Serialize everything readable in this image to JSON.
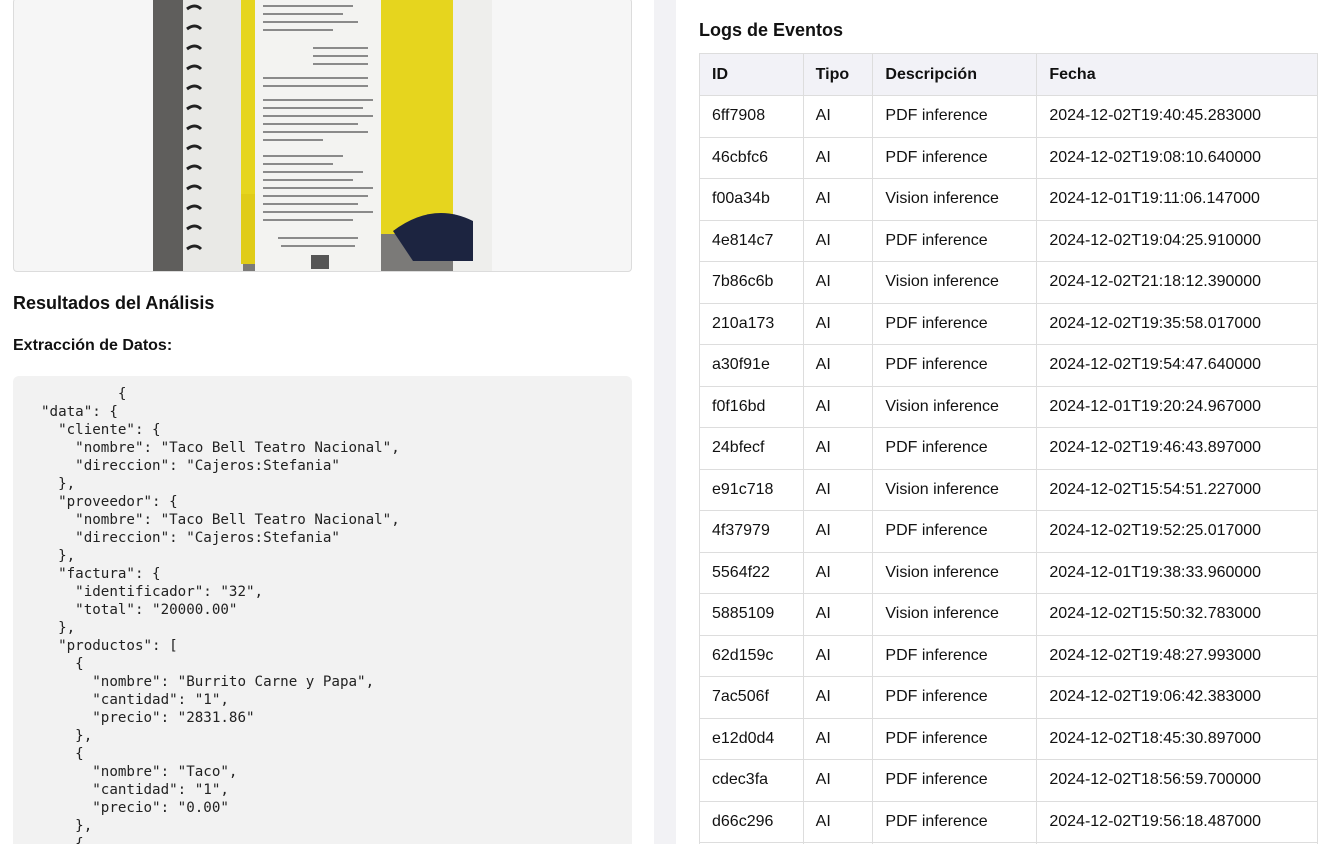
{
  "left_panel": {
    "receipt_image_alt": "Taco Bell Teatro Nacional receipt",
    "analysis_title": "Resultados del Análisis",
    "extraction_title": "Extracción de Datos:",
    "json_output": "         {\n\"data\": {\n  \"cliente\": {\n    \"nombre\": \"Taco Bell Teatro Nacional\",\n    \"direccion\": \"Cajeros:Stefania\"\n  },\n  \"proveedor\": {\n    \"nombre\": \"Taco Bell Teatro Nacional\",\n    \"direccion\": \"Cajeros:Stefania\"\n  },\n  \"factura\": {\n    \"identificador\": \"32\",\n    \"total\": \"20000.00\"\n  },\n  \"productos\": [\n    {\n      \"nombre\": \"Burrito Carne y Papa\",\n      \"cantidad\": \"1\",\n      \"precio\": \"2831.86\"\n    },\n    {\n      \"nombre\": \"Taco\",\n      \"cantidad\": \"1\",\n      \"precio\": \"0.00\"\n    },\n    {"
  },
  "logs": {
    "title": "Logs de Eventos",
    "columns": [
      "ID",
      "Tipo",
      "Descripción",
      "Fecha"
    ],
    "rows": [
      {
        "id": "6ff7908",
        "tipo": "AI",
        "descripcion": "PDF inference",
        "fecha": "2024-12-02T19:40:45.283000"
      },
      {
        "id": "46cbfc6",
        "tipo": "AI",
        "descripcion": "PDF inference",
        "fecha": "2024-12-02T19:08:10.640000"
      },
      {
        "id": "f00a34b",
        "tipo": "AI",
        "descripcion": "Vision inference",
        "fecha": "2024-12-01T19:11:06.147000"
      },
      {
        "id": "4e814c7",
        "tipo": "AI",
        "descripcion": "PDF inference",
        "fecha": "2024-12-02T19:04:25.910000"
      },
      {
        "id": "7b86c6b",
        "tipo": "AI",
        "descripcion": "Vision inference",
        "fecha": "2024-12-02T21:18:12.390000"
      },
      {
        "id": "210a173",
        "tipo": "AI",
        "descripcion": "PDF inference",
        "fecha": "2024-12-02T19:35:58.017000"
      },
      {
        "id": "a30f91e",
        "tipo": "AI",
        "descripcion": "PDF inference",
        "fecha": "2024-12-02T19:54:47.640000"
      },
      {
        "id": "f0f16bd",
        "tipo": "AI",
        "descripcion": "Vision inference",
        "fecha": "2024-12-01T19:20:24.967000"
      },
      {
        "id": "24bfecf",
        "tipo": "AI",
        "descripcion": "PDF inference",
        "fecha": "2024-12-02T19:46:43.897000"
      },
      {
        "id": "e91c718",
        "tipo": "AI",
        "descripcion": "Vision inference",
        "fecha": "2024-12-02T15:54:51.227000"
      },
      {
        "id": "4f37979",
        "tipo": "AI",
        "descripcion": "PDF inference",
        "fecha": "2024-12-02T19:52:25.017000"
      },
      {
        "id": "5564f22",
        "tipo": "AI",
        "descripcion": "Vision inference",
        "fecha": "2024-12-01T19:38:33.960000"
      },
      {
        "id": "5885109",
        "tipo": "AI",
        "descripcion": "Vision inference",
        "fecha": "2024-12-02T15:50:32.783000"
      },
      {
        "id": "62d159c",
        "tipo": "AI",
        "descripcion": "PDF inference",
        "fecha": "2024-12-02T19:48:27.993000"
      },
      {
        "id": "7ac506f",
        "tipo": "AI",
        "descripcion": "PDF inference",
        "fecha": "2024-12-02T19:06:42.383000"
      },
      {
        "id": "e12d0d4",
        "tipo": "AI",
        "descripcion": "PDF inference",
        "fecha": "2024-12-02T18:45:30.897000"
      },
      {
        "id": "cdec3fa",
        "tipo": "AI",
        "descripcion": "PDF inference",
        "fecha": "2024-12-02T18:56:59.700000"
      },
      {
        "id": "d66c296",
        "tipo": "AI",
        "descripcion": "PDF inference",
        "fecha": "2024-12-02T19:56:18.487000"
      },
      {
        "id": "",
        "tipo": "",
        "descripcion": "",
        "fecha": ""
      }
    ]
  }
}
